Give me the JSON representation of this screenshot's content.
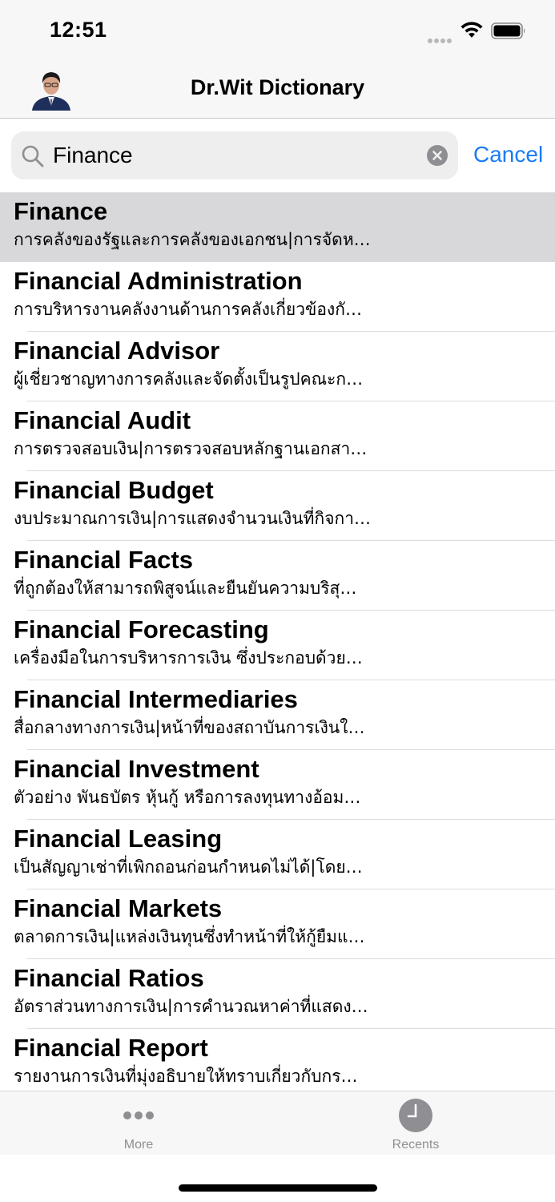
{
  "status_bar": {
    "time": "12:51"
  },
  "nav": {
    "title": "Dr.Wit Dictionary",
    "avatar_icon": "author-portrait"
  },
  "search": {
    "query": "Finance",
    "cancel_label": "Cancel",
    "accent_color": "#1a7cf5"
  },
  "results": [
    {
      "term": "Finance",
      "definition": "การคลังของรัฐและการคลังของเอกชน|การจัดห…",
      "selected": true
    },
    {
      "term": "Financial Administration",
      "definition": "การบริหารงานคลังงานด้านการคลังเกี่ยวข้องกั…"
    },
    {
      "term": "Financial Advisor",
      "definition": "ผู้เชี่ยวชาญทางการคลังและจัดตั้งเป็นรูปคณะก…"
    },
    {
      "term": "Financial Audit",
      "definition": "การตรวจสอบเงิน|การตรวจสอบหลักฐานเอกสา…"
    },
    {
      "term": "Financial Budget",
      "definition": "งบประมาณการเงิน|การแสดงจำนวนเงินที่กิจกา…"
    },
    {
      "term": "Financial Facts",
      "definition": "ที่ถูกต้องให้สามารถพิสูจน์และยืนยันความบริสุ…"
    },
    {
      "term": "Financial Forecasting",
      "definition": "เครื่องมือในการบริหารการเงิน ซึ่งประกอบด้วย…"
    },
    {
      "term": "Financial Intermediaries",
      "definition": "สื่อกลางทางการเงิน|หน้าที่ของสถาบันการเงินใ…"
    },
    {
      "term": "Financial Investment",
      "definition": "ตัวอย่าง พันธบัตร หุ้นกู้ หรือการลงทุนทางอ้อม…"
    },
    {
      "term": "Financial Leasing",
      "definition": "เป็นสัญญาเช่าที่เพิกถอนก่อนกำหนดไม่ได้|โดย…"
    },
    {
      "term": "Financial Markets",
      "definition": "ตลาดการเงิน|แหล่งเงินทุนซึ่งทำหน้าที่ให้กู้ยืมแ…"
    },
    {
      "term": "Financial Ratios",
      "definition": "อัตราส่วนทางการเงิน|การคำนวณหาค่าที่แสดง…"
    },
    {
      "term": "Financial Report",
      "definition": "รายงานการเงินที่มุ่งอธิบายให้ทราบเกี่ยวกับกร…"
    }
  ],
  "tab_bar": {
    "more": {
      "label": "More",
      "icon": "more-dots-icon"
    },
    "recents": {
      "label": "Recents",
      "icon": "clock-icon"
    }
  }
}
